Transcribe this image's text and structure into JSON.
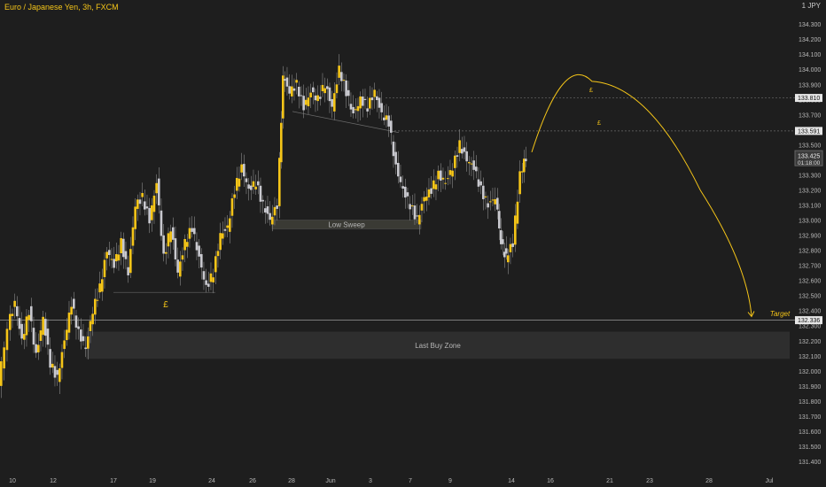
{
  "header": {
    "title": "Euro / Japanese Yen, 3h, FXCM",
    "currency": "JPY",
    "corner_tick": "1"
  },
  "colors": {
    "background": "#1e1e1e",
    "bull_candle": "#f5c518",
    "bear_candle": "#c9c9cf",
    "accent": "#f5c518",
    "grid": "#2a2a2a",
    "axis_text": "#b9b9b9"
  },
  "chart_data": {
    "type": "candlestick",
    "title": "Euro / Japanese Yen, 3h, FXCM",
    "xlabel": "",
    "ylabel": "",
    "ylim": [
      131.3,
      134.42
    ],
    "grid": false,
    "y_ticks": [
      "134.300",
      "134.200",
      "134.100",
      "134.000",
      "133.900",
      "133.800",
      "133.700",
      "133.600",
      "133.500",
      "133.400",
      "133.300",
      "133.200",
      "133.100",
      "133.000",
      "132.900",
      "132.800",
      "132.700",
      "132.600",
      "132.500",
      "132.400",
      "132.300",
      "132.200",
      "132.100",
      "132.000",
      "131.900",
      "131.800",
      "131.700",
      "131.600",
      "131.500",
      "131.400"
    ],
    "x_ticks": [
      "10",
      "12",
      "17",
      "19",
      "24",
      "26",
      "28",
      "Jun",
      "3",
      "7",
      "9",
      "14",
      "16",
      "21",
      "23",
      "28",
      "Jul"
    ],
    "price_labels": [
      {
        "label": "133.810",
        "value": 133.81,
        "style": "level"
      },
      {
        "label": "133.591",
        "value": 133.591,
        "style": "level"
      },
      {
        "label": "133.425",
        "sublabel": "01:18:00",
        "value": 133.425,
        "style": "current"
      },
      {
        "label": "132.336",
        "value": 132.336,
        "style": "level"
      }
    ],
    "horizontal_levels": [
      133.81,
      133.591,
      132.336
    ],
    "zones": [
      {
        "label": "Low Sweep",
        "top": 133.0,
        "bottom": 132.95
      },
      {
        "label": "Last Buy Zone",
        "top": 132.26,
        "bottom": 132.08
      }
    ],
    "annotations": [
      {
        "text": "£",
        "x": "19",
        "price": 132.42
      },
      {
        "text": "£",
        "x": "21",
        "price": 133.86
      },
      {
        "text": "£",
        "x": "21",
        "price": 133.63
      },
      {
        "text": "Target",
        "x": "Jul",
        "price": 132.36
      }
    ],
    "projection_path": [
      {
        "x": "16",
        "price": 133.45
      },
      {
        "x": "19",
        "price": 133.88
      },
      {
        "x": "21",
        "price": 133.92
      },
      {
        "x": "23",
        "price": 133.78
      },
      {
        "x": "28",
        "price": 133.2
      },
      {
        "x": "Jul",
        "price": 132.36
      }
    ]
  }
}
